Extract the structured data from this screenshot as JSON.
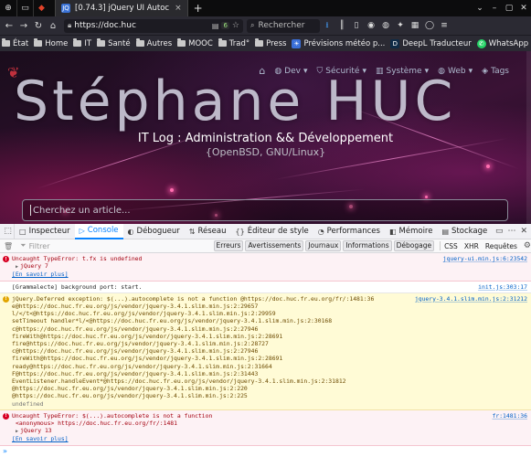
{
  "browser": {
    "tab_title": "[0.74.3] jQuery UI Autoc",
    "tab_favicon_letter": "JQ",
    "tab_close": "×",
    "new_tab": "+",
    "url": "https://doc.huc",
    "url_badge": "6",
    "search_placeholder": "Rechercher",
    "pinned_tabs": [
      "firefox-icon",
      "folder-icon",
      "gitlab-icon"
    ]
  },
  "bookmarks": [
    {
      "label": "État",
      "icon": "folder"
    },
    {
      "label": "Home",
      "icon": "folder"
    },
    {
      "label": "IT",
      "icon": "folder"
    },
    {
      "label": "Santé",
      "icon": "folder"
    },
    {
      "label": "Autres",
      "icon": "folder"
    },
    {
      "label": "MOOC",
      "icon": "folder"
    },
    {
      "label": "Trad°",
      "icon": "folder"
    },
    {
      "label": "Press",
      "icon": "folder"
    },
    {
      "label": "Prévisions météo p...",
      "icon": "weather"
    },
    {
      "label": "DeepL Traducteur",
      "icon": "deepl"
    },
    {
      "label": "WhatsApp",
      "icon": "whatsapp"
    }
  ],
  "site": {
    "menu": [
      {
        "label": "Dev",
        "icon": "globe-icon"
      },
      {
        "label": "Sécurité",
        "icon": "shield-icon"
      },
      {
        "label": "Système",
        "icon": "server-icon"
      },
      {
        "label": "Web",
        "icon": "globe-icon"
      },
      {
        "label": "Tags",
        "icon": "tag-icon"
      }
    ],
    "title": "Stéphane HUC",
    "subtitle": "IT Log : Administration && Développement",
    "subtitle2": "{OpenBSD, GNU/Linux}",
    "search_placeholder": "Cherchez un article..."
  },
  "devtools": {
    "tabs": [
      {
        "label": "Inspecteur",
        "icon": "□",
        "active": false
      },
      {
        "label": "Console",
        "icon": "▷",
        "active": true
      },
      {
        "label": "Débogueur",
        "icon": "◐",
        "active": false
      },
      {
        "label": "Réseau",
        "icon": "⇅",
        "active": false
      },
      {
        "label": "Éditeur de style",
        "icon": "{}",
        "active": false
      },
      {
        "label": "Performances",
        "icon": "◔",
        "active": false
      },
      {
        "label": "Mémoire",
        "icon": "◧",
        "active": false
      },
      {
        "label": "Stockage",
        "icon": "▤",
        "active": false
      }
    ],
    "filter_placeholder": "Filtrer",
    "filter_chips": [
      "Erreurs",
      "Avertissements",
      "Journaux",
      "Informations",
      "Débogage"
    ],
    "filter_plain": [
      "CSS",
      "XHR",
      "Requêtes"
    ],
    "prompt": "»"
  },
  "console": {
    "messages": [
      {
        "type": "error",
        "source": "jquery-ui.min.js:6:23542",
        "lines": [
          {
            "text": "Uncaught TypeError: t.fx is undefined",
            "style": "plain"
          },
          {
            "text": "jQuery 7",
            "style": "toggle"
          },
          {
            "text": "[En savoir plus]",
            "style": "link"
          }
        ]
      },
      {
        "type": "log",
        "source": "init.js:303:17",
        "lines": [
          {
            "text": "[Grammalecte] background port: start.",
            "style": "plain"
          }
        ]
      },
      {
        "type": "warn",
        "source": "jquery-3.4.1.slim.min.js:2:31212",
        "lines": [
          {
            "text": "jQuery.Deferred exception: $(...).autocomplete is not a function @https://doc.huc.fr.eu.org/fr/:1481:36",
            "style": "plain"
          },
          {
            "text": "e@https://doc.huc.fr.eu.org/js/vendor/jquery-3.4.1.slim.min.js:2:29657",
            "style": "plain"
          },
          {
            "text": "l/</t<@https://doc.huc.fr.eu.org/js/vendor/jquery-3.4.1.slim.min.js:2:29959",
            "style": "plain"
          },
          {
            "text": "setTimeout handler*l/<@https://doc.huc.fr.eu.org/js/vendor/jquery-3.4.1.slim.min.js:2:30168",
            "style": "plain"
          },
          {
            "text": "c@https://doc.huc.fr.eu.org/js/vendor/jquery-3.4.1.slim.min.js:2:27946",
            "style": "plain"
          },
          {
            "text": "fireWith@https://doc.huc.fr.eu.org/js/vendor/jquery-3.4.1.slim.min.js:2:28691",
            "style": "plain"
          },
          {
            "text": "fire@https://doc.huc.fr.eu.org/js/vendor/jquery-3.4.1.slim.min.js:2:28727",
            "style": "plain"
          },
          {
            "text": "c@https://doc.huc.fr.eu.org/js/vendor/jquery-3.4.1.slim.min.js:2:27946",
            "style": "plain"
          },
          {
            "text": "fireWith@https://doc.huc.fr.eu.org/js/vendor/jquery-3.4.1.slim.min.js:2:28691",
            "style": "plain"
          },
          {
            "text": "ready@https://doc.huc.fr.eu.org/js/vendor/jquery-3.4.1.slim.min.js:2:31664",
            "style": "plain"
          },
          {
            "text": "F@https://doc.huc.fr.eu.org/js/vendor/jquery-3.4.1.slim.min.js:2:31443",
            "style": "plain"
          },
          {
            "text": "EventListener.handleEvent*@https://doc.huc.fr.eu.org/js/vendor/jquery-3.4.1.slim.min.js:2:31812",
            "style": "plain"
          },
          {
            "text": "@https://doc.huc.fr.eu.org/js/vendor/jquery-3.4.1.slim.min.js:2:220",
            "style": "plain"
          },
          {
            "text": "@https://doc.huc.fr.eu.org/js/vendor/jquery-3.4.1.slim.min.js:2:225",
            "style": "plain"
          },
          {
            "text": "undefined",
            "style": "muted"
          }
        ]
      },
      {
        "type": "error",
        "source": "fr:1481:36",
        "lines": [
          {
            "text": "Uncaught TypeError: $(...).autocomplete is not a function",
            "style": "plain"
          },
          {
            "text": "<anonymous> https://doc.huc.fr.eu.org/fr/:1481",
            "style": "frame"
          },
          {
            "text": "jQuery 13",
            "style": "toggle"
          },
          {
            "text": "[En savoir plus]",
            "style": "link"
          }
        ]
      }
    ]
  }
}
